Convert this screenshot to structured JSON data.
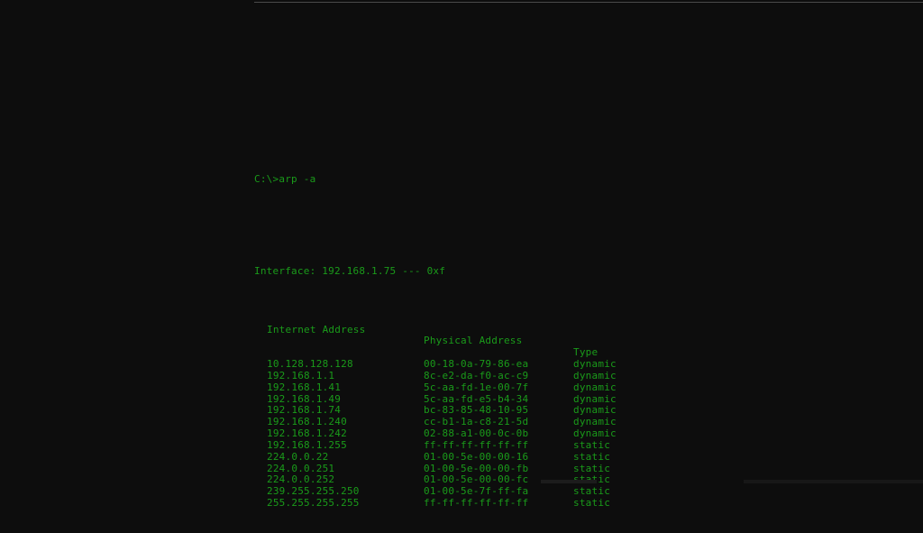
{
  "terminal": {
    "prompt_line": "C:\\>arp -a",
    "interface_line": "Interface: 192.168.1.75 --- 0xf",
    "interface": {
      "label": "Interface:",
      "ip": "192.168.1.75",
      "separator": "---",
      "id": "0xf"
    },
    "columns": {
      "internet_address": "Internet Address",
      "physical_address": "Physical Address",
      "type": "Type"
    },
    "entries": [
      {
        "internet_address": "10.128.128.128",
        "physical_address": "00-18-0a-79-86-ea",
        "type": "dynamic"
      },
      {
        "internet_address": "192.168.1.1",
        "physical_address": "8c-e2-da-f0-ac-c9",
        "type": "dynamic"
      },
      {
        "internet_address": "192.168.1.41",
        "physical_address": "5c-aa-fd-1e-00-7f",
        "type": "dynamic"
      },
      {
        "internet_address": "192.168.1.49",
        "physical_address": "5c-aa-fd-e5-b4-34",
        "type": "dynamic"
      },
      {
        "internet_address": "192.168.1.74",
        "physical_address": "bc-83-85-48-10-95",
        "type": "dynamic"
      },
      {
        "internet_address": "192.168.1.240",
        "physical_address": "cc-b1-1a-c8-21-5d",
        "type": "dynamic"
      },
      {
        "internet_address": "192.168.1.242",
        "physical_address": "02-88-a1-00-0c-0b",
        "type": "dynamic"
      },
      {
        "internet_address": "192.168.1.255",
        "physical_address": "ff-ff-ff-ff-ff-ff",
        "type": "static"
      },
      {
        "internet_address": "224.0.0.22",
        "physical_address": "01-00-5e-00-00-16",
        "type": "static"
      },
      {
        "internet_address": "224.0.0.251",
        "physical_address": "01-00-5e-00-00-fb",
        "type": "static"
      },
      {
        "internet_address": "224.0.0.252",
        "physical_address": "01-00-5e-00-00-fc",
        "type": "static"
      },
      {
        "internet_address": "239.255.255.250",
        "physical_address": "01-00-5e-7f-ff-fa",
        "type": "static"
      },
      {
        "internet_address": "255.255.255.255",
        "physical_address": "ff-ff-ff-ff-ff-ff",
        "type": "static"
      }
    ],
    "colors": {
      "background": "#0d0d0d",
      "text": "#1a9b1a",
      "rule": "#4a4a4a"
    }
  }
}
